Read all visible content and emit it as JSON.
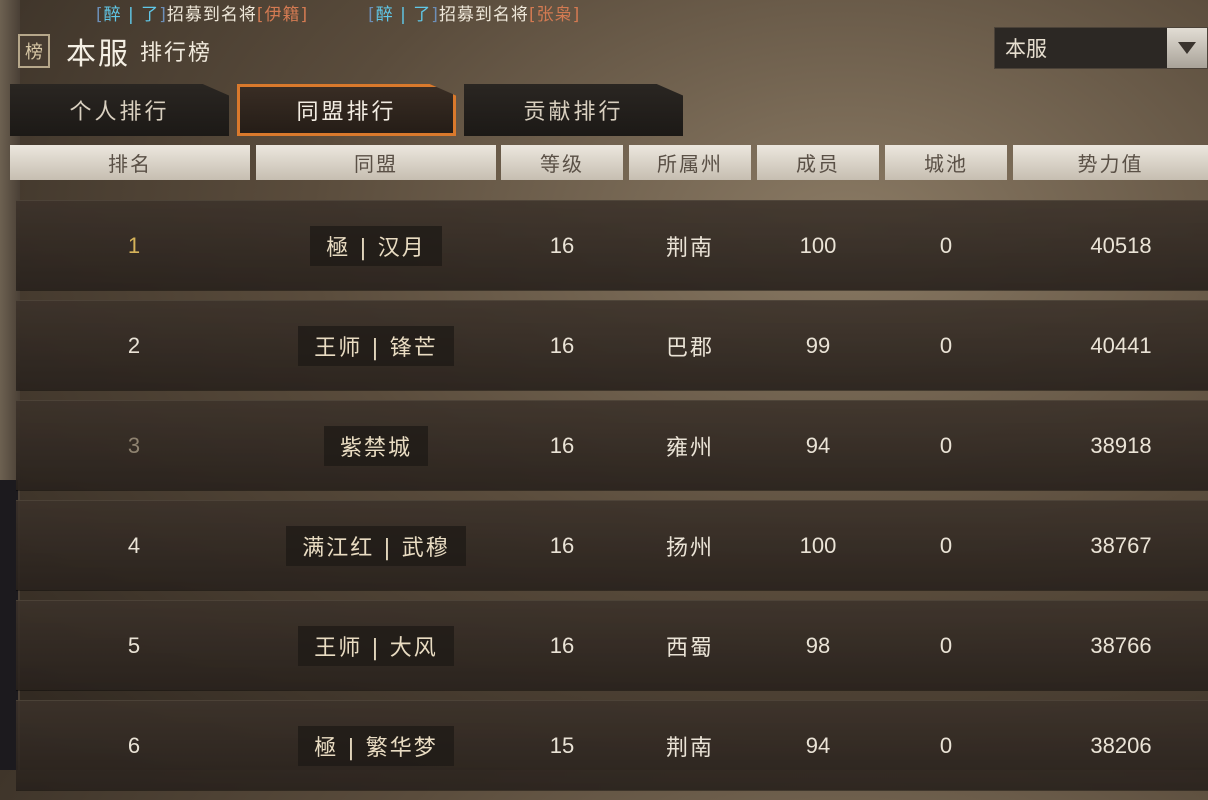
{
  "announcement": [
    {
      "bracket_open": "[",
      "player": "醉 | 了",
      "bracket_close": "]",
      "message": "招募到名将",
      "hero_open": "[",
      "hero": "伊籍",
      "hero_close": "]"
    },
    {
      "bracket_open": "[",
      "player": "醉 | 了",
      "bracket_close": "]",
      "message": "招募到名将",
      "hero_open": "[",
      "hero": "张枭",
      "hero_close": "]"
    }
  ],
  "title": {
    "icon_glyph": "榜",
    "main": "本服",
    "sub": "排行榜"
  },
  "server_select": {
    "value": "本服"
  },
  "tabs": [
    {
      "label": "个人排行",
      "active": false
    },
    {
      "label": "同盟排行",
      "active": true
    },
    {
      "label": "贡献排行",
      "active": false
    }
  ],
  "columns": {
    "rank": "排名",
    "alliance": "同盟",
    "level": "等级",
    "region": "所属州",
    "members": "成员",
    "cities": "城池",
    "power": "势力值"
  },
  "rows": [
    {
      "rank": "1",
      "alliance": "極 | 汉月",
      "level": "16",
      "region": "荆南",
      "members": "100",
      "cities": "0",
      "power": "40518"
    },
    {
      "rank": "2",
      "alliance": "王师 | 锋芒",
      "level": "16",
      "region": "巴郡",
      "members": "99",
      "cities": "0",
      "power": "40441"
    },
    {
      "rank": "3",
      "alliance": "紫禁城",
      "level": "16",
      "region": "雍州",
      "members": "94",
      "cities": "0",
      "power": "38918"
    },
    {
      "rank": "4",
      "alliance": "满江红 | 武穆",
      "level": "16",
      "region": "扬州",
      "members": "100",
      "cities": "0",
      "power": "38767"
    },
    {
      "rank": "5",
      "alliance": "王师 | 大风",
      "level": "16",
      "region": "西蜀",
      "members": "98",
      "cities": "0",
      "power": "38766"
    },
    {
      "rank": "6",
      "alliance": "極 | 繁华梦",
      "level": "15",
      "region": "荆南",
      "members": "94",
      "cities": "0",
      "power": "38206"
    }
  ],
  "colors": {
    "accent": "#d9792c",
    "header_bg": "#e2ddd4",
    "rank1": "#d6b35a"
  }
}
